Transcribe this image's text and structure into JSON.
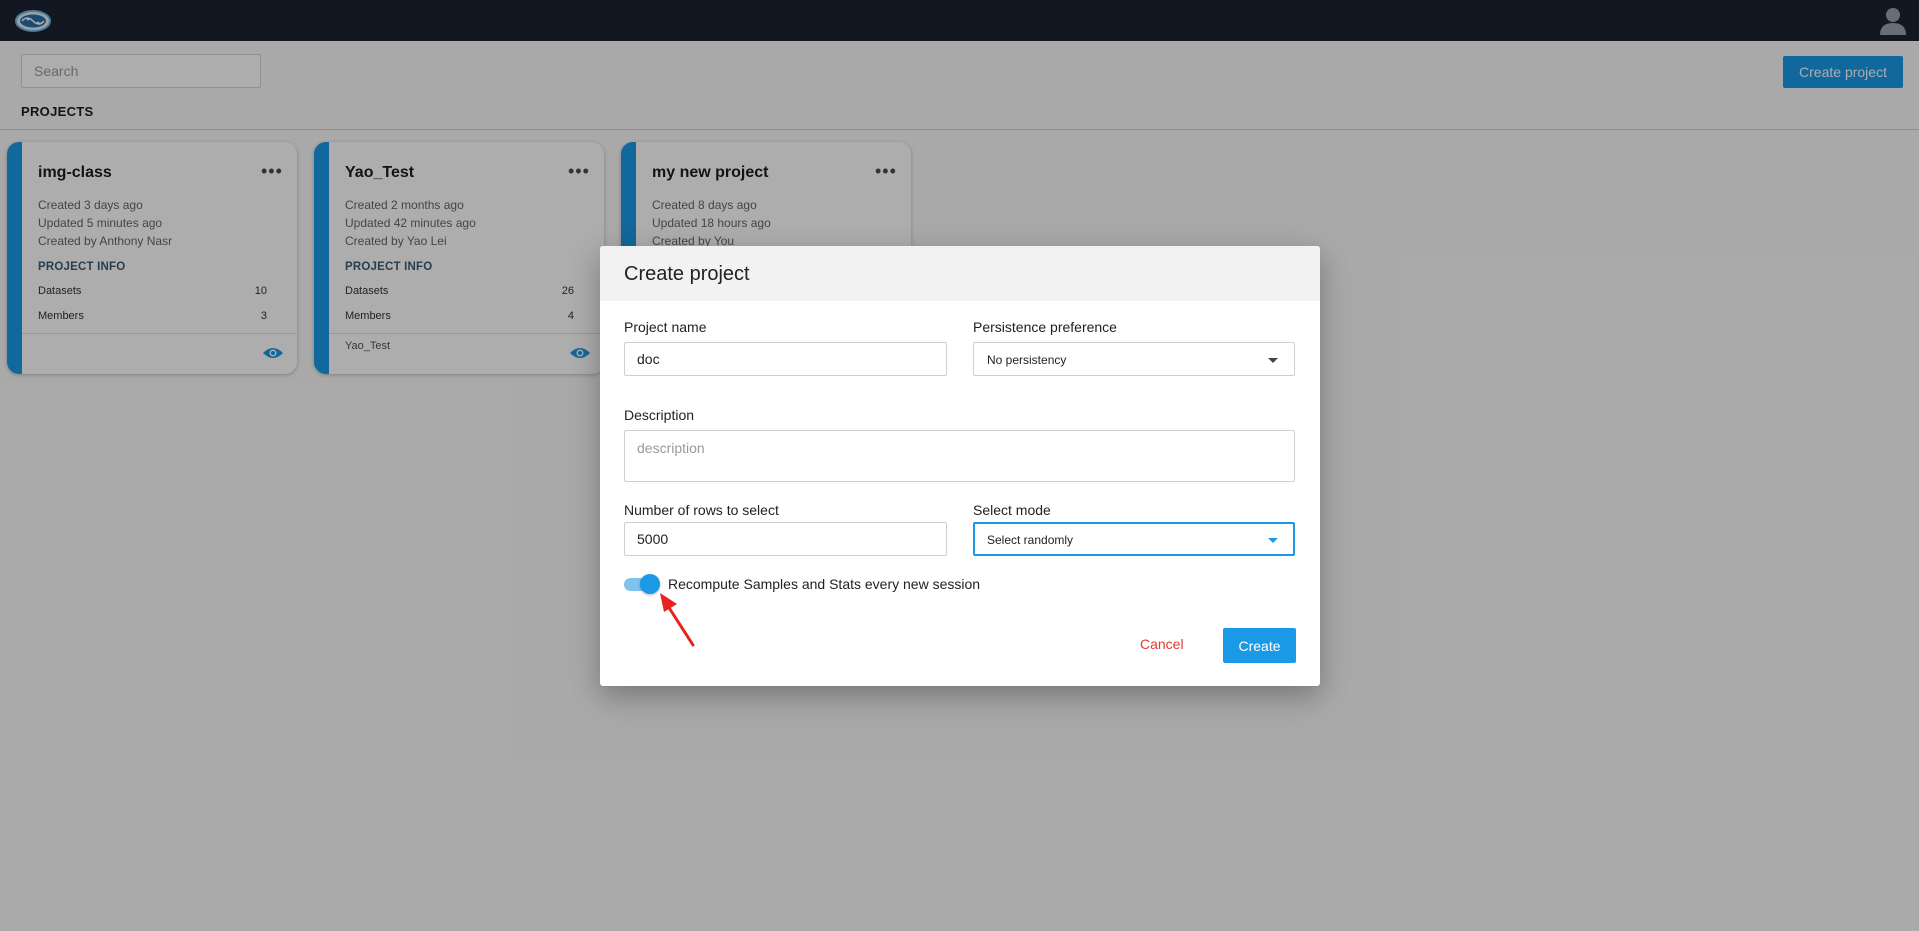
{
  "search": {
    "placeholder": "Search"
  },
  "toolbar": {
    "create_project_label": "Create project"
  },
  "projects_heading": "PROJECTS",
  "cards": [
    {
      "title": "img-class",
      "created": "Created 3 days ago",
      "updated": "Updated 5 minutes ago",
      "created_by": "Created by Anthony Nasr",
      "info_heading": "PROJECT INFO",
      "datasets_label": "Datasets",
      "datasets_count": "10",
      "members_label": "Members",
      "members_count": "3",
      "footer_text": ""
    },
    {
      "title": "Yao_Test",
      "created": "Created 2 months ago",
      "updated": "Updated 42 minutes ago",
      "created_by": "Created by Yao Lei",
      "info_heading": "PROJECT INFO",
      "datasets_label": "Datasets",
      "datasets_count": "26",
      "members_label": "Members",
      "members_count": "4",
      "footer_text": "Yao_Test"
    },
    {
      "title": "my new project",
      "created": "Created 8 days ago",
      "updated": "Updated 18 hours ago",
      "created_by": "Created by You"
    }
  ],
  "dialog": {
    "title": "Create project",
    "project_name_label": "Project name",
    "project_name_value": "doc",
    "persistence_label": "Persistence preference",
    "persistence_value": "No persistency",
    "description_label": "Description",
    "description_placeholder": "description",
    "rows_label": "Number of rows to select",
    "rows_value": "5000",
    "select_mode_label": "Select mode",
    "select_mode_value": "Select randomly",
    "toggle_label": "Recompute Samples and Stats every new session",
    "toggle_on": true,
    "cancel_label": "Cancel",
    "create_label": "Create"
  },
  "colors": {
    "accent": "#1a9ae6",
    "topbar": "#1b2333",
    "cancel": "#e53935",
    "annotation_arrow": "#e8231f"
  }
}
